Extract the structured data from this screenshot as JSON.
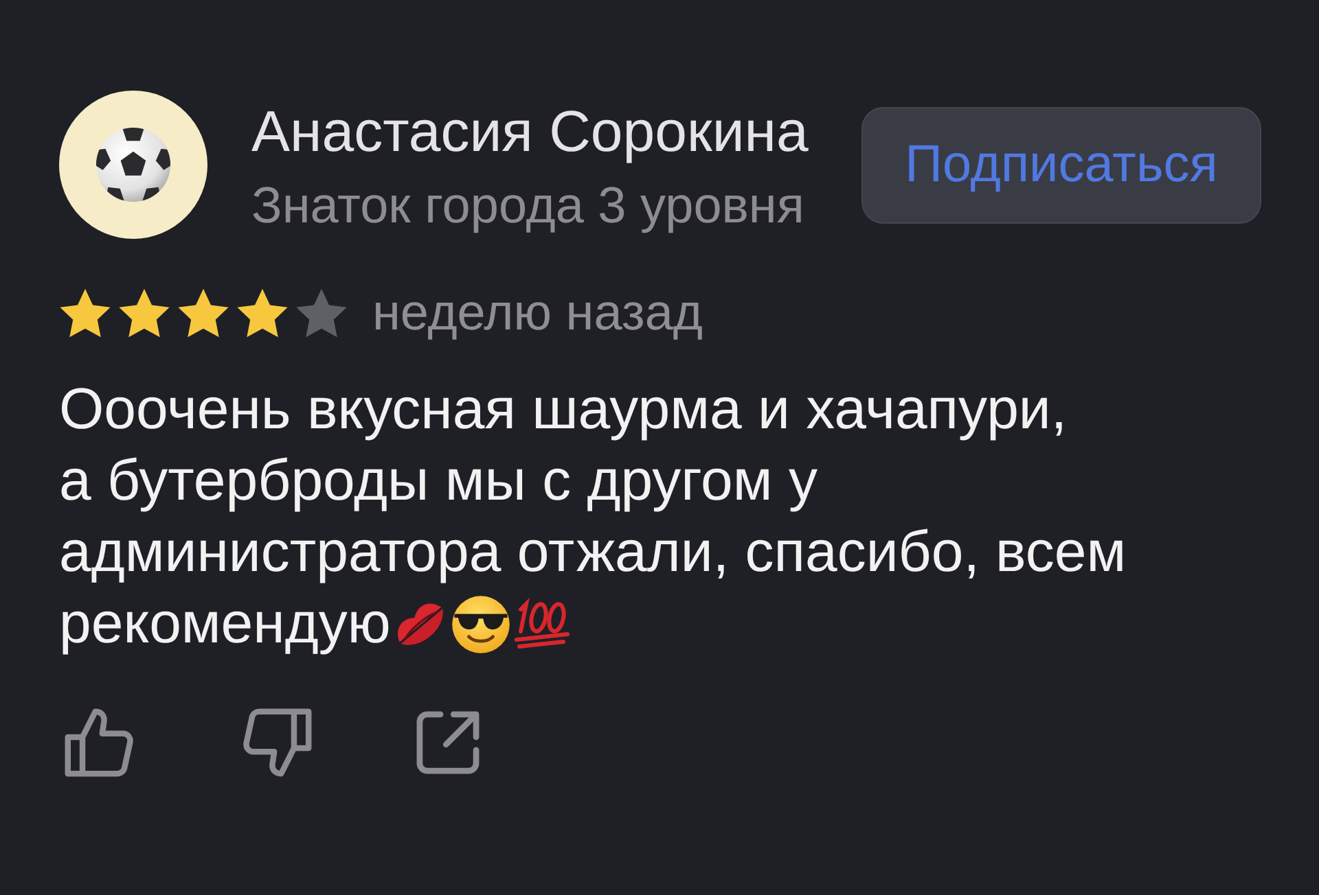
{
  "review": {
    "author": {
      "name": "Анастасия Сорокина",
      "badge": "Знаток города 3 уровня"
    },
    "subscribe_button": "Подписаться",
    "stars": 4,
    "date": "неделю назад",
    "text_lines": [
      "Ооочень вкусная шаурма и хачапури,",
      "а бутерброды мы с другом у",
      "администратора отжали, спасибо, всем",
      "рекомендую"
    ]
  }
}
